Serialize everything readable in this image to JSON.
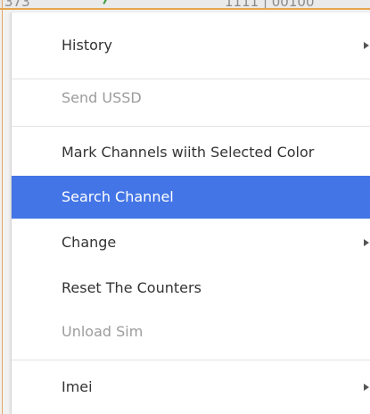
{
  "background": {
    "left_fragment": "373",
    "right_fragment": "1111 | 00100"
  },
  "menu": {
    "items": [
      {
        "label": "History",
        "enabled": true,
        "submenu": true
      },
      {
        "label": "Send USSD",
        "enabled": false,
        "submenu": false
      },
      {
        "label": "Mark Channels wiith Selected Color",
        "enabled": true,
        "submenu": false
      },
      {
        "label": "Search Channel",
        "enabled": true,
        "submenu": false,
        "selected": true
      },
      {
        "label": "Change",
        "enabled": true,
        "submenu": true
      },
      {
        "label": "Reset The Counters",
        "enabled": true,
        "submenu": false
      },
      {
        "label": "Unload Sim",
        "enabled": false,
        "submenu": false
      },
      {
        "label": "Imei",
        "enabled": true,
        "submenu": true
      }
    ]
  },
  "colors": {
    "selection": "#4375e6",
    "window_border": "#e7a64c",
    "disabled_text": "#9c9c9c"
  }
}
